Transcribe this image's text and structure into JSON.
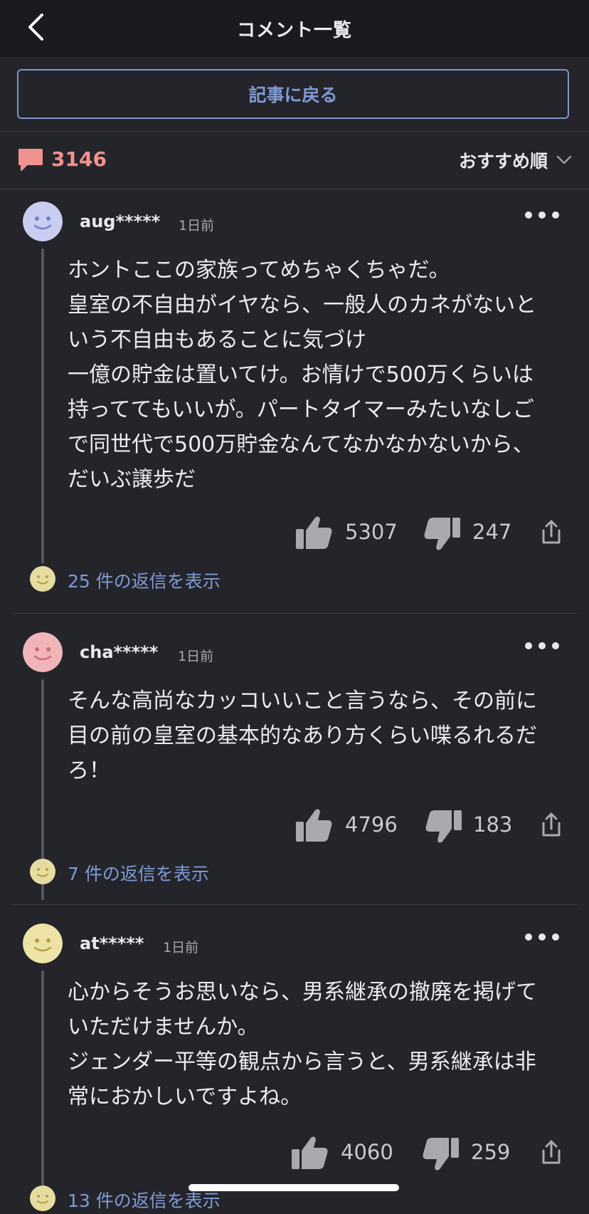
{
  "header": {
    "title": "コメント一覧"
  },
  "return_button": "記事に戻る",
  "comment_count": "3146",
  "sort": {
    "label": "おすすめ順"
  },
  "comments": [
    {
      "user": "aug*****",
      "time": "1日前",
      "avatar_color": "#c9cdf0",
      "text": "ホントここの家族ってめちゃくちゃだ。\n皇室の不自由がイヤなら、一般人のカネがないと\nいう不自由もあることに気づけ\n一億の貯金は置いてけ。お情けで500万くらいは\n持っててもいいが。パートタイマーみたいなしご\nで同世代で500万貯金なんてなかなかないから、\nだいぶ譲歩だ",
      "likes": "5307",
      "dislikes": "247",
      "replies": "25 件の返信を表示"
    },
    {
      "user": "cha*****",
      "time": "1日前",
      "avatar_color": "#f0b5b8",
      "text": "そんな高尚なカッコいいこと言うなら、その前に\n目の前の皇室の基本的なあり方くらい喋るれるだ\nろ！",
      "likes": "4796",
      "dislikes": "183",
      "replies": "7 件の返信を表示"
    },
    {
      "user": "at*****",
      "time": "1日前",
      "avatar_color": "#ede3a6",
      "text": "心からそうお思いなら、男系継承の撤廃を掲げて\nいただけませんか。\nジェンダー平等の観点から言うと、男系継承は非\n常におかしいですよね。",
      "likes": "4060",
      "dislikes": "259",
      "replies": "13 件の返信を表示"
    }
  ],
  "colors": {
    "background": "#24252b",
    "header_bg": "#1a1b20",
    "accent_blue": "#7f9ad4",
    "accent_red": "#f0928e",
    "icon_gray": "#a9aaae"
  }
}
